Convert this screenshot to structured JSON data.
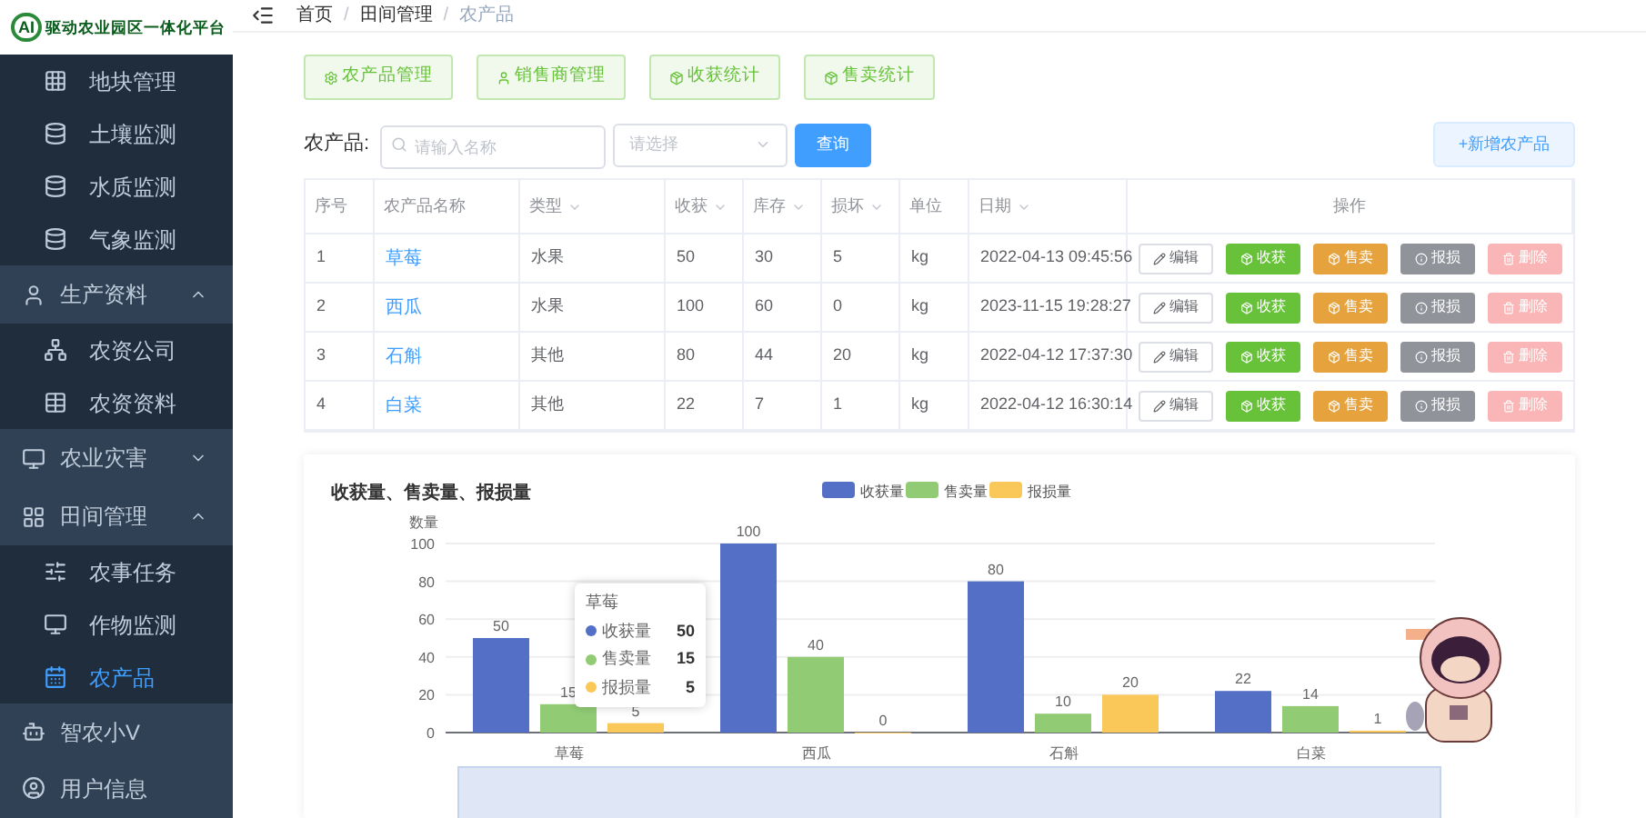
{
  "logo": {
    "mark": "AI",
    "text": "驱动农业园区一体化平台"
  },
  "sidebar": {
    "items": [
      {
        "kind": "sub",
        "label": "地块管理",
        "selected": false
      },
      {
        "kind": "sub",
        "label": "土壤监测",
        "selected": false
      },
      {
        "kind": "sub",
        "label": "水质监测",
        "selected": false
      },
      {
        "kind": "sub",
        "label": "气象监测",
        "selected": false
      },
      {
        "kind": "group",
        "label": "生产资料",
        "expanded": true,
        "children": [
          {
            "label": "农资公司",
            "selected": false
          },
          {
            "label": "农资资料",
            "selected": false
          }
        ]
      },
      {
        "kind": "group",
        "label": "农业灾害",
        "expanded": false
      },
      {
        "kind": "group",
        "label": "田间管理",
        "expanded": true,
        "children": [
          {
            "label": "农事任务",
            "selected": false
          },
          {
            "label": "作物监测",
            "selected": false
          },
          {
            "label": "农产品",
            "selected": true
          }
        ]
      },
      {
        "kind": "single",
        "label": "智农小V"
      },
      {
        "kind": "single",
        "label": "用户信息"
      }
    ]
  },
  "breadcrumb": [
    {
      "kind": "link",
      "label": "首页"
    },
    {
      "kind": "separator",
      "label": "/"
    },
    {
      "kind": "link",
      "label": "田间管理"
    },
    {
      "kind": "separator",
      "label": "/"
    },
    {
      "kind": "current",
      "label": "农产品"
    }
  ],
  "top_buttons": [
    {
      "label": "农产品管理"
    },
    {
      "label": "销售商管理"
    },
    {
      "label": "收获统计"
    },
    {
      "label": "售卖统计"
    }
  ],
  "search": {
    "label": "农产品:",
    "placeholder": "请输入名称",
    "select_placeholder": "请选择",
    "query": "查询",
    "add": "+新增农产品"
  },
  "table": {
    "columns": [
      {
        "label": "序号",
        "sortable": false
      },
      {
        "label": "农产品名称",
        "sortable": false
      },
      {
        "label": "类型",
        "sortable": true
      },
      {
        "label": "收获",
        "sortable": true
      },
      {
        "label": "库存",
        "sortable": true
      },
      {
        "label": "损坏",
        "sortable": true
      },
      {
        "label": "单位",
        "sortable": false
      },
      {
        "label": "日期",
        "sortable": true
      },
      {
        "label": "操作",
        "sortable": false
      }
    ],
    "rows": [
      {
        "cells": [
          "1",
          "草莓",
          "水果",
          "50",
          "30",
          "5",
          "kg",
          "2022-04-13 09:45:56"
        ],
        "actions": [
          {
            "kind": "edit",
            "label": "编辑"
          },
          {
            "kind": "harvest",
            "label": "收获"
          },
          {
            "kind": "sell",
            "label": "售卖"
          },
          {
            "kind": "loss",
            "label": "报损"
          },
          {
            "kind": "delete",
            "label": "删除"
          }
        ]
      },
      {
        "cells": [
          "2",
          "西瓜",
          "水果",
          "100",
          "60",
          "0",
          "kg",
          "2023-11-15 19:28:27"
        ],
        "actions": [
          {
            "kind": "edit",
            "label": "编辑"
          },
          {
            "kind": "harvest",
            "label": "收获"
          },
          {
            "kind": "sell",
            "label": "售卖"
          },
          {
            "kind": "loss",
            "label": "报损"
          },
          {
            "kind": "delete",
            "label": "删除"
          }
        ]
      },
      {
        "cells": [
          "3",
          "石斛",
          "其他",
          "80",
          "44",
          "20",
          "kg",
          "2022-04-12 17:37:30"
        ],
        "actions": [
          {
            "kind": "edit",
            "label": "编辑"
          },
          {
            "kind": "harvest",
            "label": "收获"
          },
          {
            "kind": "sell",
            "label": "售卖"
          },
          {
            "kind": "loss",
            "label": "报损"
          },
          {
            "kind": "delete",
            "label": "删除"
          }
        ]
      },
      {
        "cells": [
          "4",
          "白菜",
          "其他",
          "22",
          "7",
          "1",
          "kg",
          "2022-04-12 16:30:14"
        ],
        "actions": [
          {
            "kind": "edit",
            "label": "编辑"
          },
          {
            "kind": "harvest",
            "label": "收获"
          },
          {
            "kind": "sell",
            "label": "售卖"
          },
          {
            "kind": "loss",
            "label": "报损"
          },
          {
            "kind": "delete",
            "label": "删除"
          }
        ]
      }
    ]
  },
  "chart": {
    "chart_data": {
      "type": "bar",
      "title": "收获量、售卖量、报损量",
      "ylabel": "数量",
      "categories": [
        "草莓",
        "西瓜",
        "石斛",
        "白菜"
      ],
      "series": [
        {
          "name": "收获量",
          "color": "#5470c6",
          "values": [
            50,
            100,
            80,
            22
          ]
        },
        {
          "name": "售卖量",
          "color": "#91cc75",
          "values": [
            15,
            40,
            10,
            14
          ]
        },
        {
          "name": "报损量",
          "color": "#fac858",
          "values": [
            5,
            0,
            20,
            1
          ]
        }
      ],
      "ylim": [
        0,
        100
      ],
      "yticks": [
        0,
        20,
        40,
        60,
        80,
        100
      ],
      "data_labels": true,
      "grid": true,
      "legend": true
    },
    "tooltip": {
      "title": "草莓",
      "rows": [
        {
          "label": "收获量",
          "value": "50",
          "color": "#5470c6"
        },
        {
          "label": "售卖量",
          "value": "15",
          "color": "#91cc75"
        },
        {
          "label": "报损量",
          "value": "5",
          "color": "#fac858"
        }
      ]
    }
  }
}
